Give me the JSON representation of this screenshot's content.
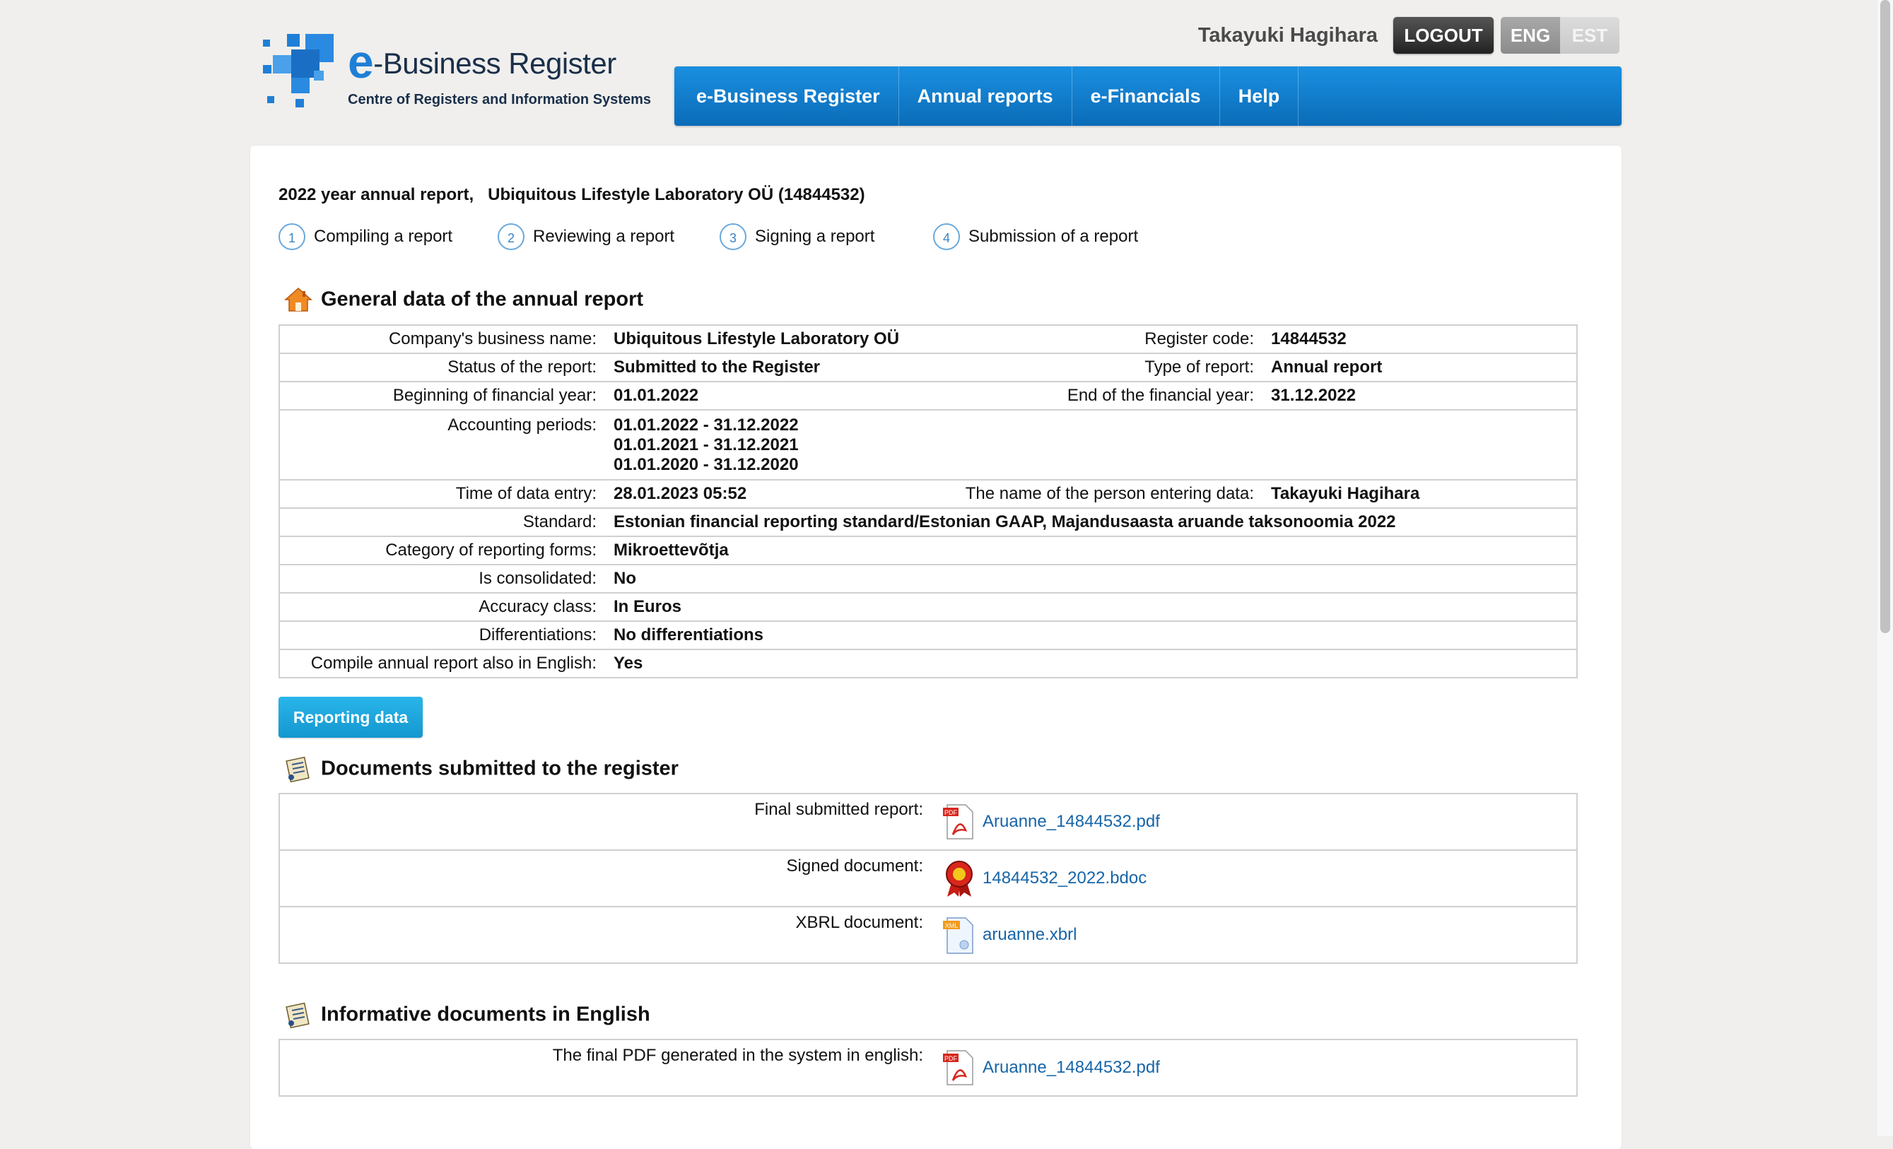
{
  "logo": {
    "title_prefix": "e",
    "title_rest": "-Business Register",
    "subtitle": "Centre of Registers and Information Systems"
  },
  "header": {
    "username": "Takayuki Hagihara",
    "logout_label": "LOGOUT",
    "lang_en": "ENG",
    "lang_et": "EST"
  },
  "nav": {
    "items": [
      "e-Business Register",
      "Annual reports",
      "e-Financials",
      "Help"
    ]
  },
  "report": {
    "title_year": "2022 year annual report,",
    "title_company": "Ubiquitous Lifestyle Laboratory OÜ (14844532)"
  },
  "steps": [
    {
      "num": "1",
      "label": "Compiling a report"
    },
    {
      "num": "2",
      "label": "Reviewing a report"
    },
    {
      "num": "3",
      "label": "Signing a report"
    },
    {
      "num": "4",
      "label": "Submission of a report"
    }
  ],
  "general": {
    "title": "General data of the annual report",
    "rows": {
      "company_name": {
        "label": "Company's business name:",
        "value": "Ubiquitous Lifestyle Laboratory OÜ"
      },
      "register_code": {
        "label": "Register code:",
        "value": "14844532"
      },
      "status": {
        "label": "Status of the report:",
        "value": "Submitted to the Register"
      },
      "type": {
        "label": "Type of report:",
        "value": "Annual report"
      },
      "fy_begin": {
        "label": "Beginning of financial year:",
        "value": "01.01.2022"
      },
      "fy_end": {
        "label": "End of the financial year:",
        "value": "31.12.2022"
      },
      "periods": {
        "label": "Accounting periods:",
        "values": [
          "01.01.2022 - 31.12.2022",
          "01.01.2021 - 31.12.2021",
          "01.01.2020 - 31.12.2020"
        ]
      },
      "entry_time": {
        "label": "Time of data entry:",
        "value": "28.01.2023 05:52"
      },
      "entry_person": {
        "label": "The name of the person entering data:",
        "value": "Takayuki Hagihara"
      },
      "standard": {
        "label": "Standard:",
        "value": "Estonian financial reporting standard/Estonian GAAP, Majandusaasta aruande taksonoomia 2022"
      },
      "category": {
        "label": "Category of reporting forms:",
        "value": "Mikroettevõtja"
      },
      "consolidated": {
        "label": "Is consolidated:",
        "value": "No"
      },
      "accuracy": {
        "label": "Accuracy class:",
        "value": "In Euros"
      },
      "differentiations": {
        "label": "Differentiations:",
        "value": "No differentiations"
      },
      "english": {
        "label": "Compile annual report also in English:",
        "value": "Yes"
      }
    },
    "button_label": "Reporting data"
  },
  "documents": {
    "title": "Documents submitted to the register",
    "rows": [
      {
        "label": "Final submitted report:",
        "file": "Aruanne_14844532.pdf",
        "icon": "pdf-icon"
      },
      {
        "label": "Signed document:",
        "file": "14844532_2022.bdoc",
        "icon": "seal-icon"
      },
      {
        "label": "XBRL document:",
        "file": "aruanne.xbrl",
        "icon": "xml-icon"
      }
    ]
  },
  "english_docs": {
    "title": "Informative documents in English",
    "rows": [
      {
        "label": "The final PDF generated in the system in english:",
        "file": "Aruanne_14844532.pdf",
        "icon": "pdf-icon"
      }
    ]
  },
  "colors": {
    "nav_blue": "#0a6cb8",
    "link_blue": "#1665a8",
    "button_cyan": "#1497cf"
  }
}
